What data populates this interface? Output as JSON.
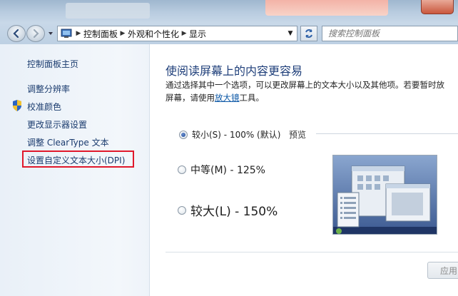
{
  "window": {
    "accent": "#1f3f7a",
    "highlight_color": "#e0182b"
  },
  "navbar": {
    "back_icon": "back-arrow-icon",
    "forward_icon": "forward-arrow-icon",
    "breadcrumb": [
      "控制面板",
      "外观和个性化",
      "显示"
    ],
    "search_placeholder": "搜索控制面板"
  },
  "sidebar": {
    "home_label": "控制面板主页",
    "items": [
      {
        "label": "调整分辨率"
      },
      {
        "label": "校准颜色",
        "icon": "shield-icon"
      },
      {
        "label": "更改显示器设置"
      },
      {
        "label": "调整 ClearType 文本"
      },
      {
        "label": "设置自定义文本大小(DPI)"
      }
    ]
  },
  "main": {
    "title": "使阅读屏幕上的内容更容易",
    "desc_line1": "通过选择其中一个选项，可以更改屏幕上的文本大小以及其他项。若要暂时放",
    "desc_line2_prefix": "屏幕，请使用",
    "desc_link": "放大镜",
    "desc_line2_suffix": "工具。",
    "preview_label": "预览",
    "options": [
      {
        "label": "较小(S) - 100% (默认)",
        "checked": true
      },
      {
        "label": "中等(M) - 125%",
        "checked": false
      },
      {
        "label": "较大(L) - 150%",
        "checked": false
      }
    ],
    "apply_label": "应用"
  }
}
